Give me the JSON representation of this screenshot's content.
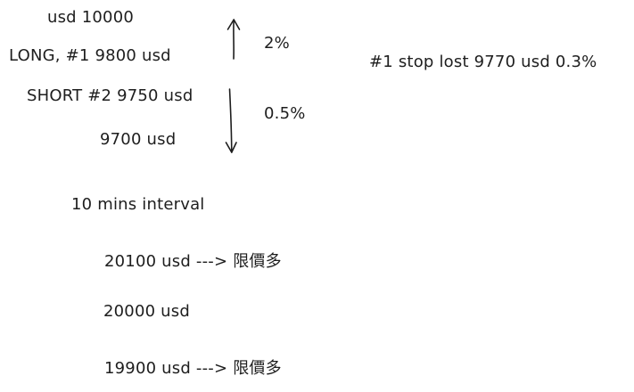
{
  "notes": {
    "balance": "usd 10000",
    "long_order": "LONG,   #1  9800 usd",
    "short_order": "SHORT #2 9750 usd",
    "lower_price": "9700 usd",
    "pct_up": "2%",
    "pct_down": "0.5%",
    "stop_loss": "#1 stop lost 9770 usd 0.3%",
    "interval": "10 mins interval",
    "upper_limit": "20100 usd ---> 限價多",
    "mid_price": "20000 usd",
    "lower_limit": "19900 usd ---> 限價多"
  },
  "colors": {
    "ink": "#1e1e1e",
    "background": "#ffffff"
  }
}
